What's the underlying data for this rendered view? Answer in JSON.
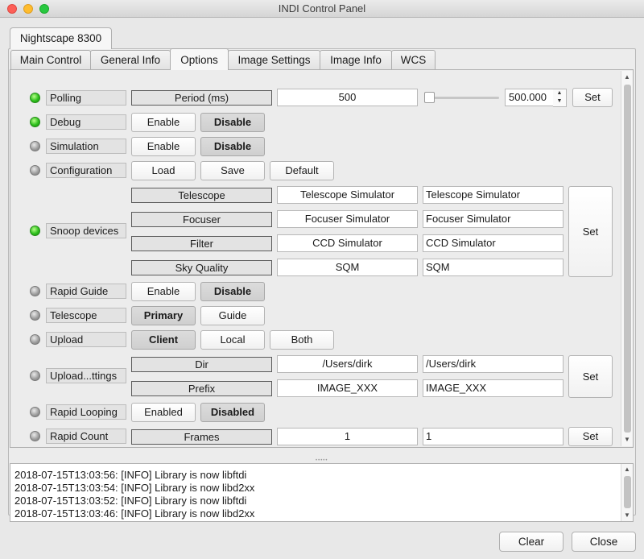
{
  "window": {
    "title": "INDI Control Panel"
  },
  "device_tab": "Nightscape 8300",
  "tabs": [
    "Main Control",
    "General Info",
    "Options",
    "Image Settings",
    "Image Info",
    "WCS"
  ],
  "polling": {
    "label": "Polling",
    "element": "Period (ms)",
    "value": "500",
    "spin_value": "500.000",
    "set_label": "Set"
  },
  "debug": {
    "label": "Debug",
    "enable": "Enable",
    "disable": "Disable"
  },
  "simulation": {
    "label": "Simulation",
    "enable": "Enable",
    "disable": "Disable"
  },
  "configuration": {
    "label": "Configuration",
    "load": "Load",
    "save": "Save",
    "default": "Default"
  },
  "snoop": {
    "label": "Snoop devices",
    "rows": [
      {
        "element": "Telescope",
        "current": "Telescope Simulator",
        "input": "Telescope Simulator"
      },
      {
        "element": "Focuser",
        "current": "Focuser Simulator",
        "input": "Focuser Simulator"
      },
      {
        "element": "Filter",
        "current": "CCD Simulator",
        "input": "CCD Simulator"
      },
      {
        "element": "Sky Quality",
        "current": "SQM",
        "input": "SQM"
      }
    ],
    "set_label": "Set"
  },
  "rapid_guide": {
    "label": "Rapid Guide",
    "enable": "Enable",
    "disable": "Disable"
  },
  "telescope": {
    "label": "Telescope",
    "primary": "Primary",
    "guide": "Guide"
  },
  "upload": {
    "label": "Upload",
    "client": "Client",
    "local": "Local",
    "both": "Both"
  },
  "upload_settings": {
    "label": "Upload...ttings",
    "rows": [
      {
        "element": "Dir",
        "current": "/Users/dirk",
        "input": "/Users/dirk"
      },
      {
        "element": "Prefix",
        "current": "IMAGE_XXX",
        "input": "IMAGE_XXX"
      }
    ],
    "set_label": "Set"
  },
  "rapid_looping": {
    "label": "Rapid Looping",
    "enabled": "Enabled",
    "disabled": "Disabled"
  },
  "rapid_count": {
    "label": "Rapid Count",
    "element": "Frames",
    "current": "1",
    "input": "1",
    "set_label": "Set"
  },
  "log": [
    "2018-07-15T13:03:56: [INFO] Library is now libftdi",
    "2018-07-15T13:03:54: [INFO] Library is now libd2xx",
    "2018-07-15T13:03:52: [INFO] Library is now libftdi",
    "2018-07-15T13:03:46: [INFO] Library is now libd2xx"
  ],
  "buttons": {
    "clear": "Clear",
    "close": "Close"
  },
  "colors": {
    "led_ok": "#2dbf1c",
    "led_idle": "#9a9a9a"
  }
}
